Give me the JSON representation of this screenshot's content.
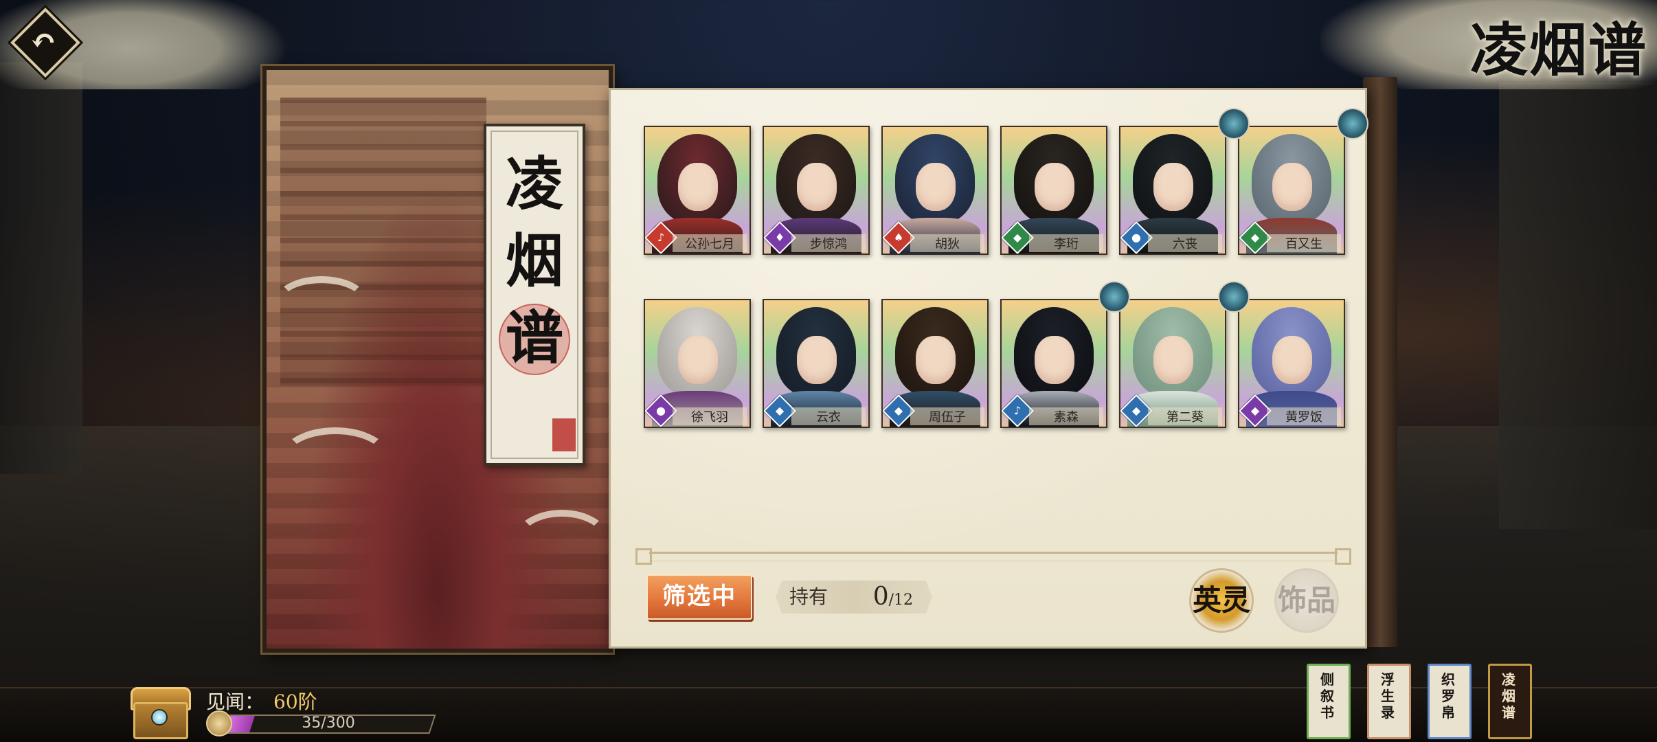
{
  "header": {
    "back_label": "↶",
    "corner_title": "凌烟谱"
  },
  "banner": {
    "chars": [
      "凌",
      "烟",
      "谱"
    ]
  },
  "cards": [
    {
      "name": "公孙七月",
      "badge_color": "#c73a2e",
      "badge_glyph": "♪",
      "palette": [
        "#6e2a2f",
        "#2a1a1c",
        "#9b2f2a"
      ]
    },
    {
      "name": "步惊鸿",
      "badge_color": "#7a3aa8",
      "badge_glyph": "♦",
      "palette": [
        "#3b2b24",
        "#1f1815",
        "#5b3a7a"
      ]
    },
    {
      "name": "胡狄",
      "badge_color": "#c73a2e",
      "badge_glyph": "♠",
      "palette": [
        "#314566",
        "#1c2438",
        "#c9a9a0"
      ]
    },
    {
      "name": "李珩",
      "badge_color": "#2f8a4a",
      "badge_glyph": "◆",
      "palette": [
        "#2a2520",
        "#141210",
        "#33475a"
      ]
    },
    {
      "name": "六丧",
      "badge_color": "#2f6fb0",
      "badge_glyph": "●",
      "palette": [
        "#1f2428",
        "#0f1214",
        "#2d3a44"
      ]
    },
    {
      "name": "百又生",
      "badge_color": "#2f8a4a",
      "badge_glyph": "◆",
      "palette": [
        "#8a97a0",
        "#5a6670",
        "#8e3a2e"
      ]
    },
    {
      "name": "徐飞羽",
      "badge_color": "#7a3aa8",
      "badge_glyph": "●",
      "palette": [
        "#d9d6d2",
        "#9e9a96",
        "#6a3a7a"
      ]
    },
    {
      "name": "云衣",
      "badge_color": "#2f6fb0",
      "badge_glyph": "◆",
      "palette": [
        "#24303e",
        "#141c26",
        "#5f86a8"
      ]
    },
    {
      "name": "周伍子",
      "badge_color": "#2f6fb0",
      "badge_glyph": "◆",
      "palette": [
        "#3a2a1e",
        "#1d150f",
        "#2f4f6a"
      ]
    },
    {
      "name": "素森",
      "badge_color": "#2f6fb0",
      "badge_glyph": "♪",
      "palette": [
        "#1c1f26",
        "#0d0f14",
        "#a7adb6"
      ]
    },
    {
      "name": "第二葵",
      "badge_color": "#2f6fb0",
      "badge_glyph": "◆",
      "palette": [
        "#9fbca8",
        "#6f8f7c",
        "#d9e4dc"
      ]
    },
    {
      "name": "黄罗饭",
      "badge_color": "#7a3aa8",
      "badge_glyph": "◆",
      "palette": [
        "#8a92c9",
        "#5a63a0",
        "#3e4a8a"
      ]
    }
  ],
  "controls": {
    "filter_label": "筛选中",
    "owned_label": "持有",
    "owned_count": "0",
    "owned_total": "/12",
    "tab_hero": "英灵",
    "tab_item": "饰品"
  },
  "player": {
    "exp_label": "见闻：",
    "level": "60阶",
    "exp_text": "35/300",
    "exp_progress": 0.117
  },
  "books": [
    {
      "title": "侧叙书"
    },
    {
      "title": "浮生录"
    },
    {
      "title": "织罗帛"
    },
    {
      "title": "凌烟谱"
    }
  ]
}
